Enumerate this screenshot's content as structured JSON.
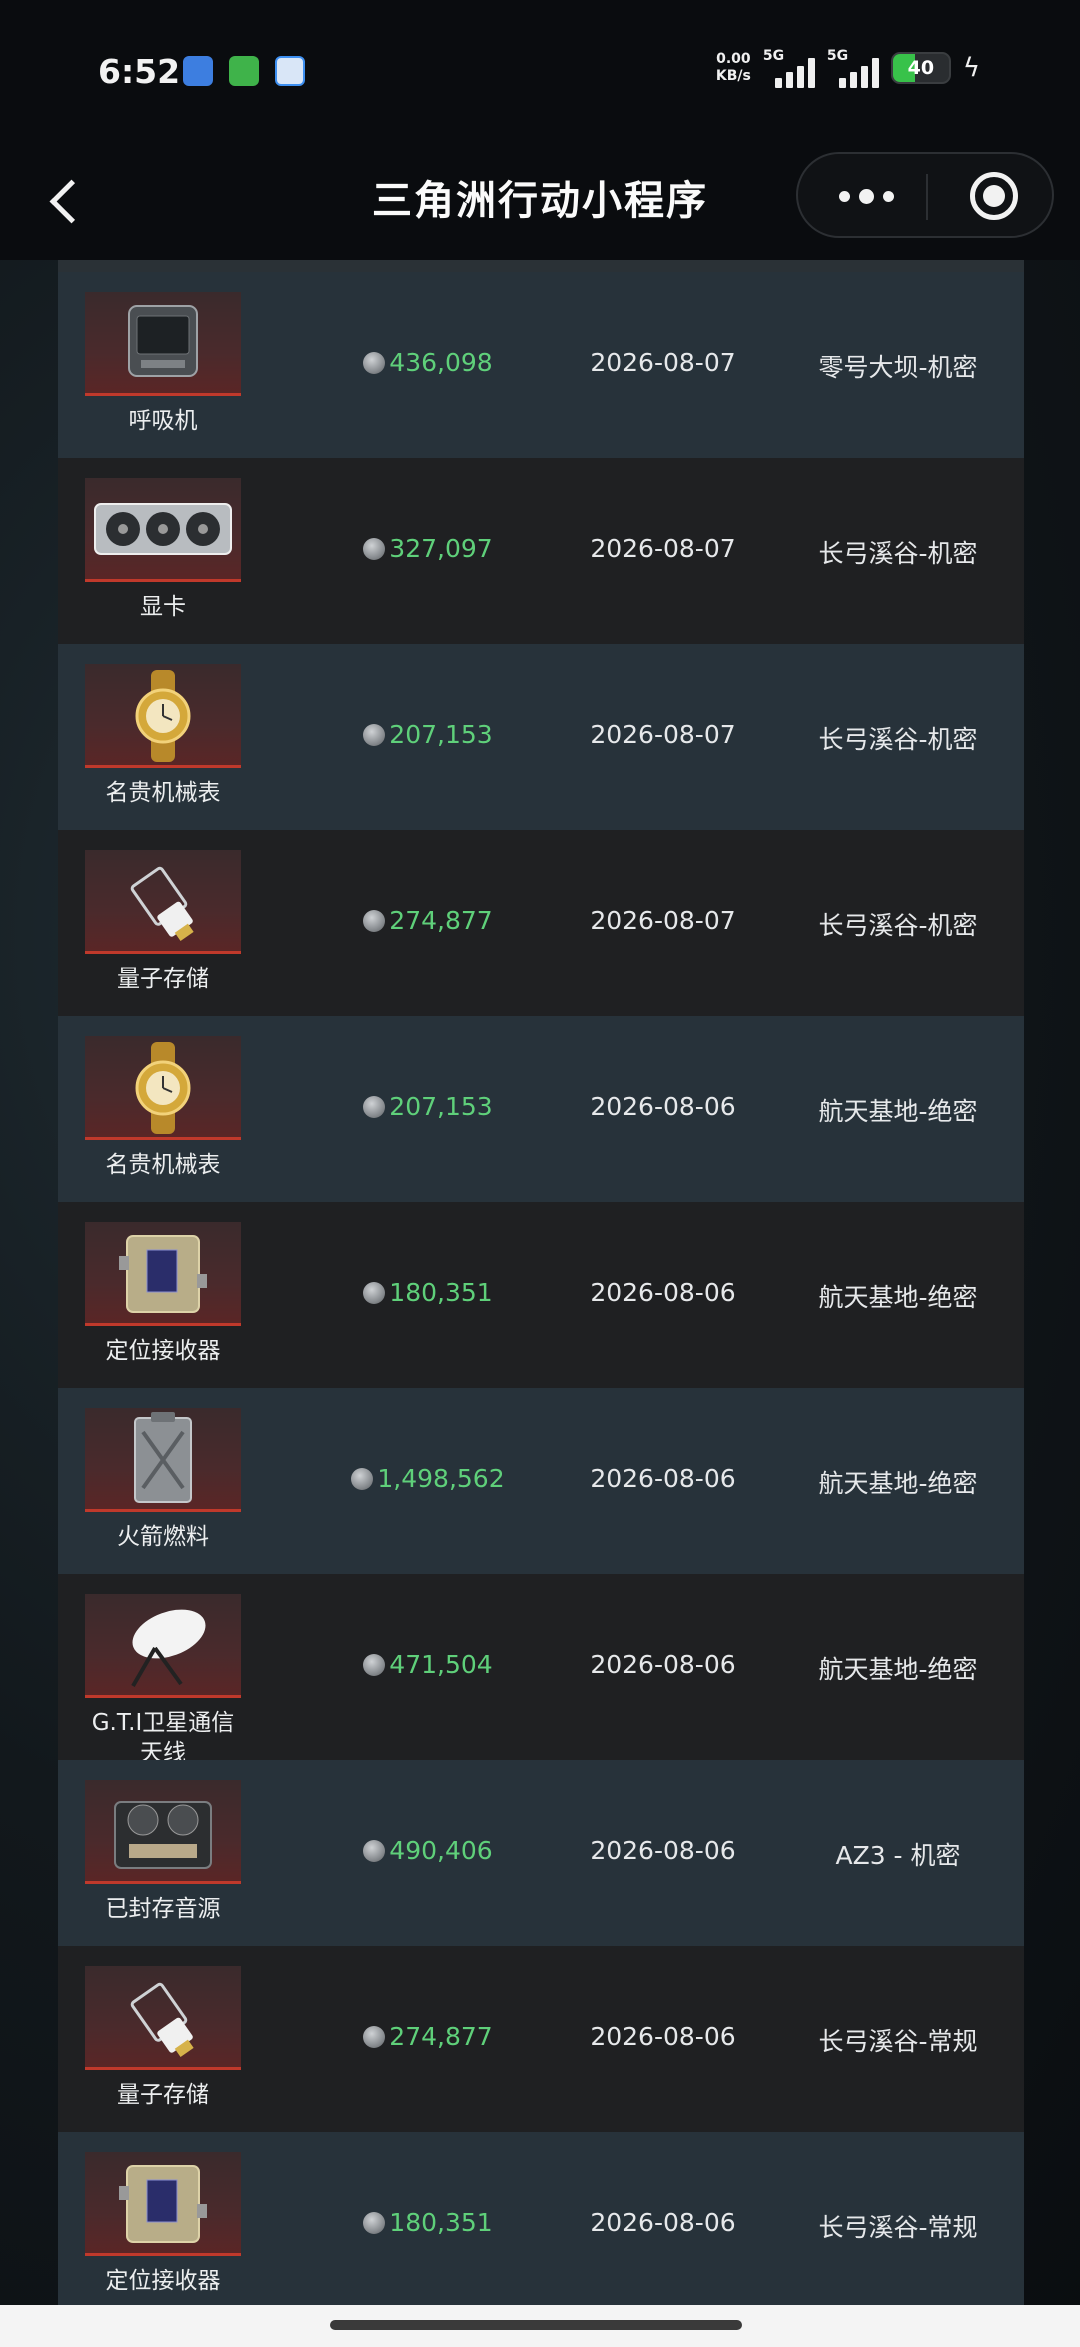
{
  "status_bar": {
    "time": "6:52",
    "net_speed_value": "0.00",
    "net_speed_unit": "KB/s",
    "sim1_tag": "5G",
    "sim2_tag": "5G",
    "battery": "40",
    "battery_level": 0.4,
    "app_icons": [
      {
        "name": "app-icon-blue",
        "color": "#3d7ee0"
      },
      {
        "name": "shield-app-icon",
        "color": "#3fb34a"
      },
      {
        "name": "dollar-app-icon",
        "color": "#3d8ff0"
      }
    ]
  },
  "nav": {
    "title": "三角洲行动小程序"
  },
  "colors": {
    "price": "#5fd07a",
    "row_light": "#27323a",
    "row_dark": "#1f2022",
    "accent_red": "#c0392b"
  },
  "records": [
    {
      "name": "呼吸机",
      "icon": "ventilator-icon",
      "price": "436,098",
      "date": "2026-08-07",
      "location": "零号大坝-机密"
    },
    {
      "name": "显卡",
      "icon": "graphics-card-icon",
      "price": "327,097",
      "date": "2026-08-07",
      "location": "长弓溪谷-机密"
    },
    {
      "name": "名贵机械表",
      "icon": "luxury-watch-icon",
      "price": "207,153",
      "date": "2026-08-07",
      "location": "长弓溪谷-机密"
    },
    {
      "name": "量子存储",
      "icon": "quantum-storage-icon",
      "price": "274,877",
      "date": "2026-08-07",
      "location": "长弓溪谷-机密"
    },
    {
      "name": "名贵机械表",
      "icon": "luxury-watch-icon",
      "price": "207,153",
      "date": "2026-08-06",
      "location": "航天基地-绝密"
    },
    {
      "name": "定位接收器",
      "icon": "gps-receiver-icon",
      "price": "180,351",
      "date": "2026-08-06",
      "location": "航天基地-绝密"
    },
    {
      "name": "火箭燃料",
      "icon": "rocket-fuel-icon",
      "price": "1,498,562",
      "date": "2026-08-06",
      "location": "航天基地-绝密"
    },
    {
      "name": "G.T.I卫星通信天线",
      "name_line1": "G.T.I卫星通信",
      "name_line2": "天线",
      "icon": "satellite-dish-icon",
      "price": "471,504",
      "date": "2026-08-06",
      "location": "航天基地-绝密"
    },
    {
      "name": "已封存音源",
      "icon": "reel-recorder-icon",
      "price": "490,406",
      "date": "2026-08-06",
      "location": "AZ3 - 机密"
    },
    {
      "name": "量子存储",
      "icon": "quantum-storage-icon",
      "price": "274,877",
      "date": "2026-08-06",
      "location": "长弓溪谷-常规"
    },
    {
      "name": "定位接收器",
      "icon": "gps-receiver-icon",
      "price": "180,351",
      "date": "2026-08-06",
      "location": "长弓溪谷-常规"
    }
  ]
}
